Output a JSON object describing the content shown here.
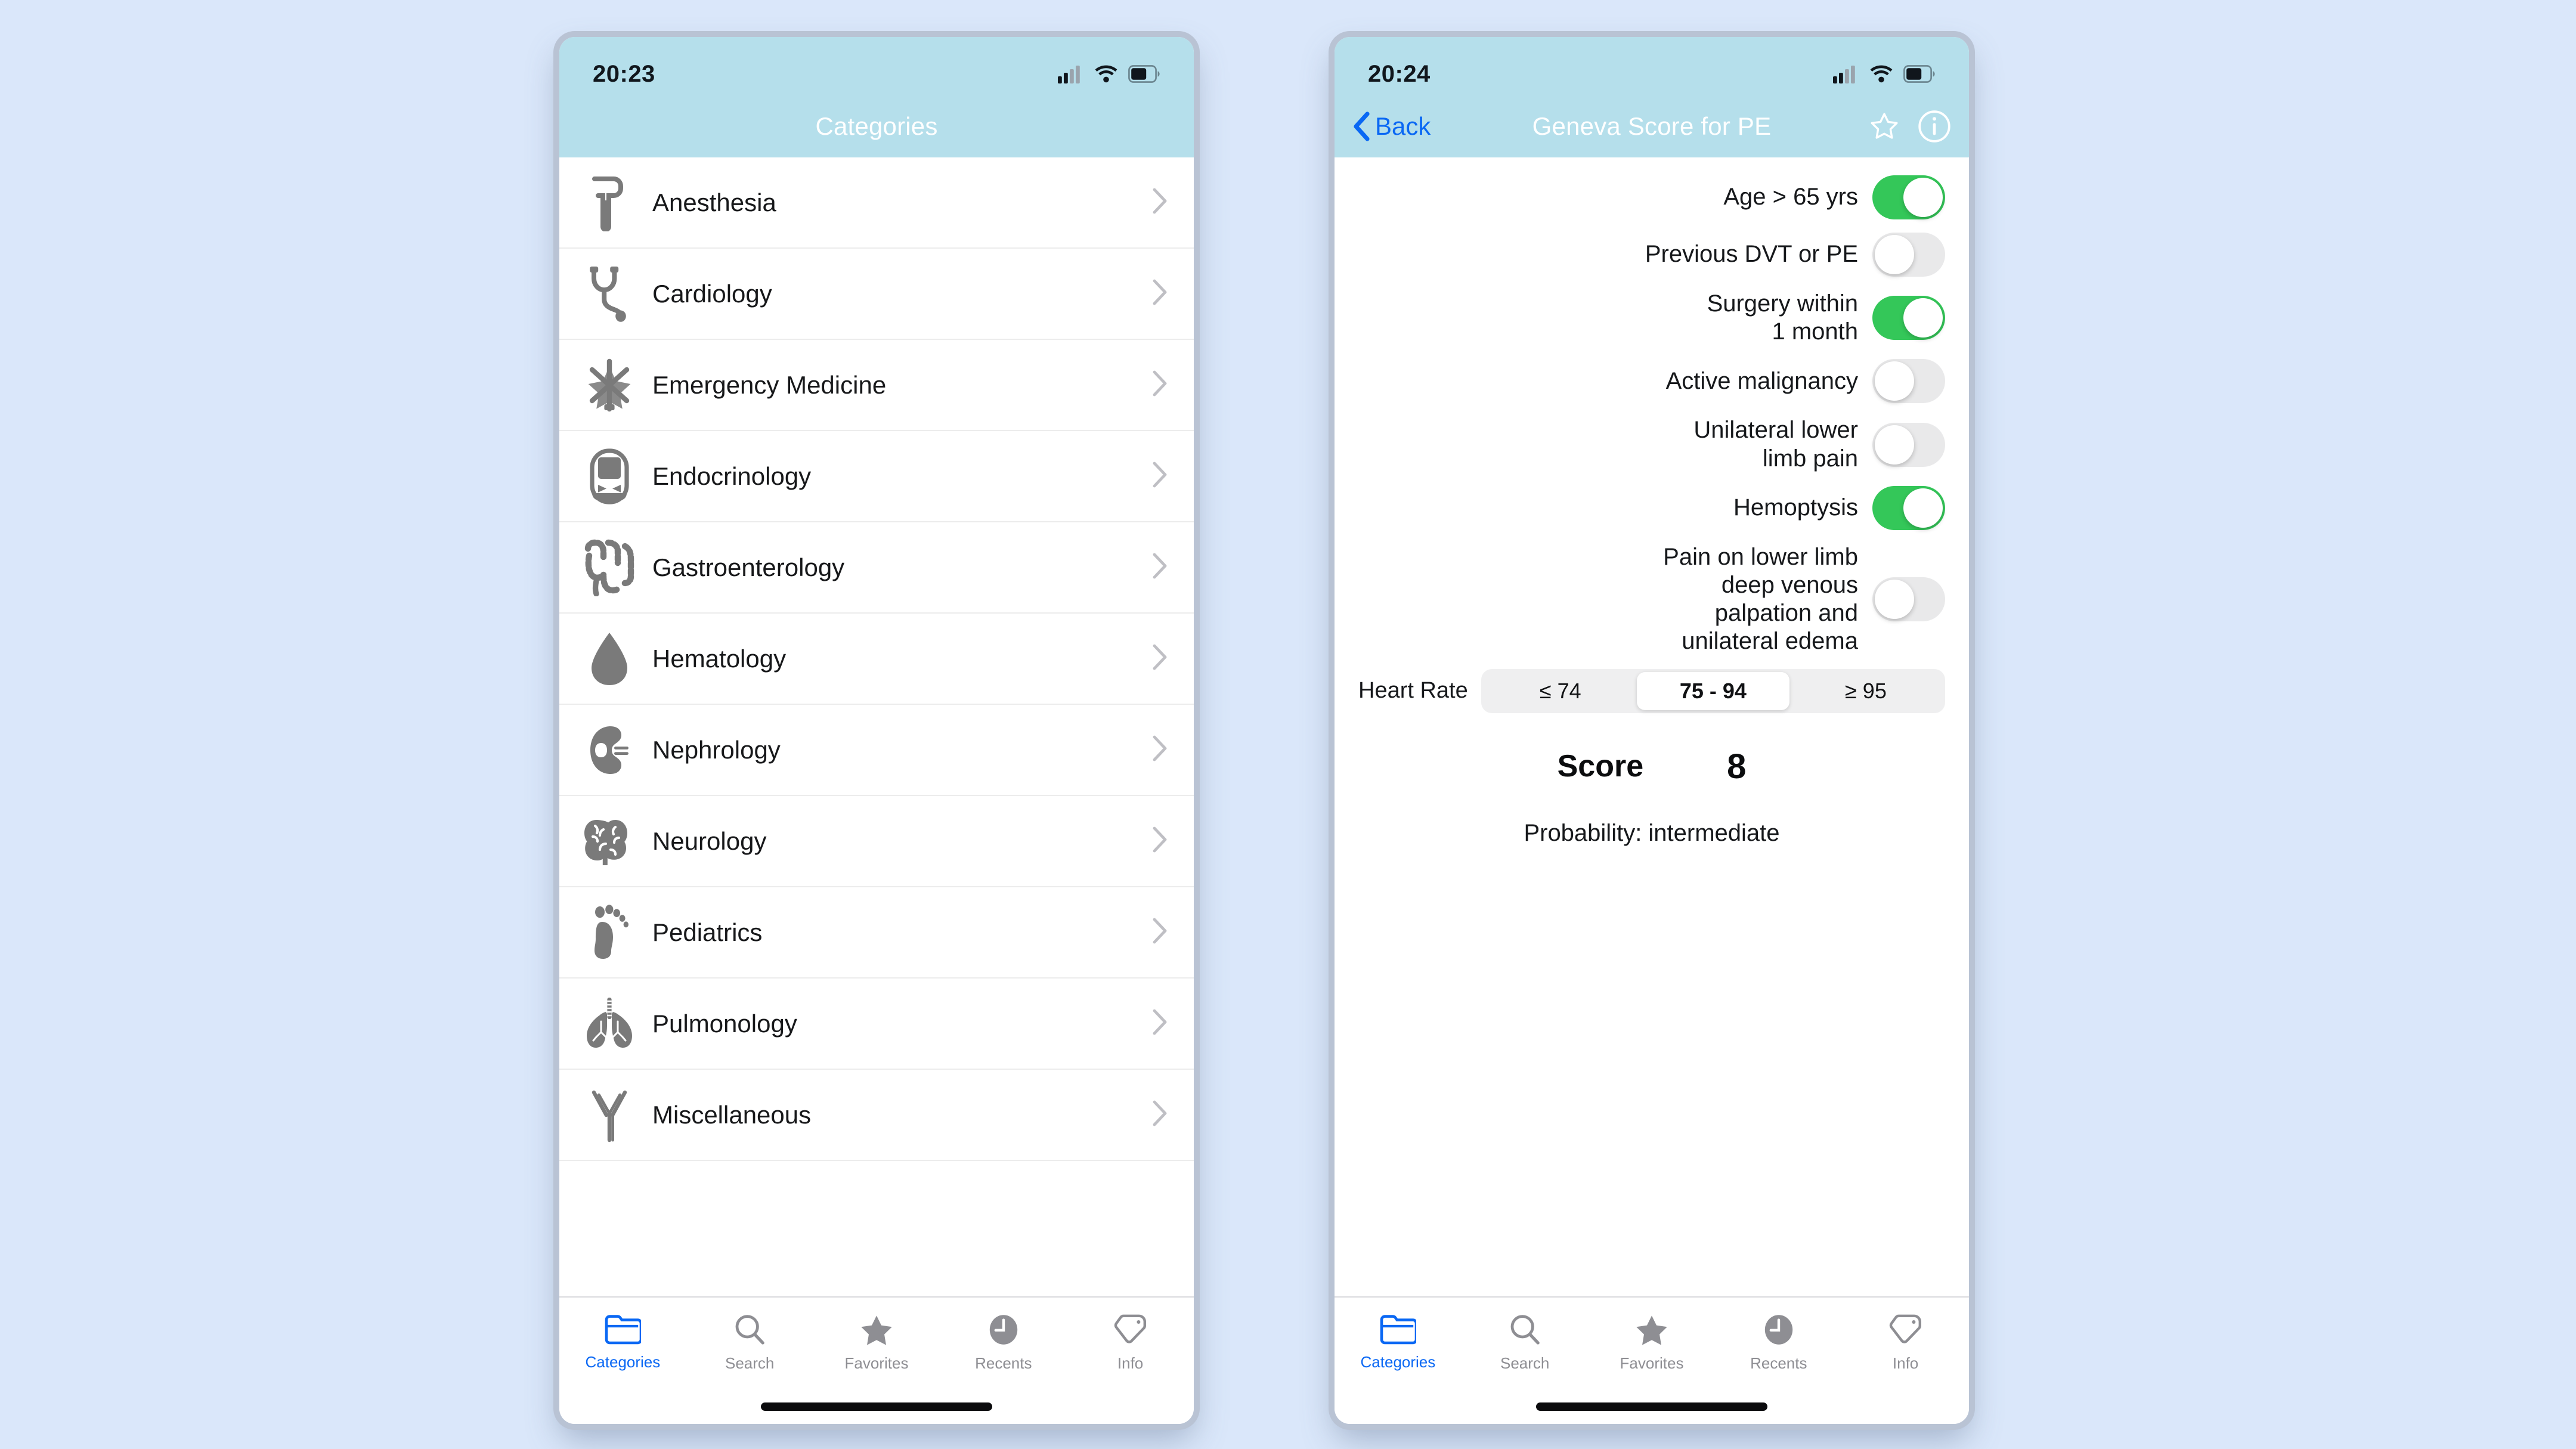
{
  "background_color": "#dae7fa",
  "theme": {
    "navbar_color": "#b5dfeb",
    "accent_blue": "#0a68f4",
    "toggle_on_green": "#34c759",
    "toggle_off_gray": "#e9e9ea",
    "icon_gray": "#7a7a7a",
    "separator": "#ececec"
  },
  "left_phone": {
    "status": {
      "time": "20:23",
      "cellular_icon": "signal-bars-icon",
      "wifi_icon": "wifi-icon",
      "battery_icon": "battery-icon"
    },
    "nav": {
      "title": "Categories"
    },
    "categories": [
      {
        "label": "Anesthesia",
        "icon": "laryngoscope-icon"
      },
      {
        "label": "Cardiology",
        "icon": "stethoscope-icon"
      },
      {
        "label": "Emergency Medicine",
        "icon": "star-of-life-icon"
      },
      {
        "label": "Endocrinology",
        "icon": "glucose-meter-icon"
      },
      {
        "label": "Gastroenterology",
        "icon": "intestine-icon"
      },
      {
        "label": "Hematology",
        "icon": "blood-drop-icon"
      },
      {
        "label": "Nephrology",
        "icon": "kidney-icon"
      },
      {
        "label": "Neurology",
        "icon": "brain-icon"
      },
      {
        "label": "Pediatrics",
        "icon": "footprint-icon"
      },
      {
        "label": "Pulmonology",
        "icon": "lungs-icon"
      },
      {
        "label": "Miscellaneous",
        "icon": "antibody-icon"
      }
    ],
    "tabs": [
      {
        "label": "Categories",
        "icon": "folder-icon",
        "active": true
      },
      {
        "label": "Search",
        "icon": "search-icon",
        "active": false
      },
      {
        "label": "Favorites",
        "icon": "star-icon",
        "active": false
      },
      {
        "label": "Recents",
        "icon": "clock-icon",
        "active": false
      },
      {
        "label": "Info",
        "icon": "tag-icon",
        "active": false
      }
    ]
  },
  "right_phone": {
    "status": {
      "time": "20:24",
      "cellular_icon": "signal-bars-icon",
      "wifi_icon": "wifi-icon",
      "battery_icon": "battery-icon"
    },
    "nav": {
      "back_label": "Back",
      "back_icon": "chevron-left-icon",
      "title": "Geneva Score for PE",
      "favorite_icon": "star-outline-icon",
      "info_icon": "info-circle-icon"
    },
    "criteria": [
      {
        "label": "Age > 65 yrs",
        "state": "on"
      },
      {
        "label": "Previous DVT or PE",
        "state": "off"
      },
      {
        "label": "Surgery within\n1 month",
        "state": "on"
      },
      {
        "label": "Active malignancy",
        "state": "off"
      },
      {
        "label": "Unilateral lower\nlimb pain",
        "state": "off"
      },
      {
        "label": "Hemoptysis",
        "state": "on"
      },
      {
        "label": "Pain on lower limb\ndeep venous\npalpation and\nunilateral edema",
        "state": "off"
      }
    ],
    "heart_rate": {
      "label": "Heart Rate",
      "options": [
        "≤ 74",
        "75 - 94",
        "≥ 95"
      ],
      "selected_index": 1,
      "selected_value": "75 - 94"
    },
    "result": {
      "score_label": "Score",
      "score_value": "8",
      "probability_text": "Probability: intermediate"
    },
    "tabs": [
      {
        "label": "Categories",
        "icon": "folder-icon",
        "active": true
      },
      {
        "label": "Search",
        "icon": "search-icon",
        "active": false
      },
      {
        "label": "Favorites",
        "icon": "star-icon",
        "active": false
      },
      {
        "label": "Recents",
        "icon": "clock-icon",
        "active": false
      },
      {
        "label": "Info",
        "icon": "tag-icon",
        "active": false
      }
    ]
  }
}
